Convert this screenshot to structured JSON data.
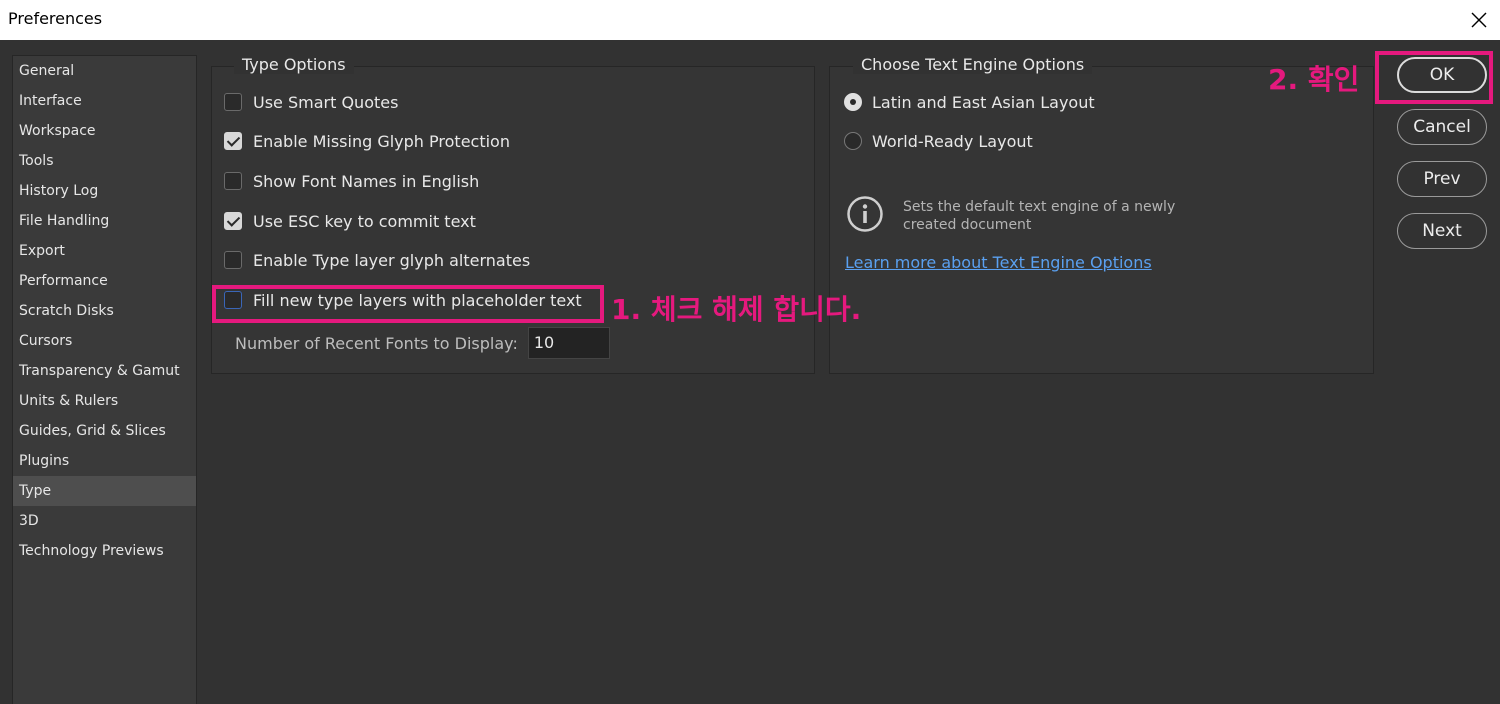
{
  "window": {
    "title": "Preferences",
    "close_icon": "close-icon"
  },
  "sidebar": {
    "items": [
      {
        "label": "General"
      },
      {
        "label": "Interface"
      },
      {
        "label": "Workspace"
      },
      {
        "label": "Tools"
      },
      {
        "label": "History Log"
      },
      {
        "label": "File Handling"
      },
      {
        "label": "Export"
      },
      {
        "label": "Performance"
      },
      {
        "label": "Scratch Disks"
      },
      {
        "label": "Cursors"
      },
      {
        "label": "Transparency & Gamut"
      },
      {
        "label": "Units & Rulers"
      },
      {
        "label": "Guides, Grid & Slices"
      },
      {
        "label": "Plugins"
      },
      {
        "label": "Type"
      },
      {
        "label": "3D"
      },
      {
        "label": "Technology Previews"
      }
    ],
    "active": "Type"
  },
  "type_options": {
    "legend": "Type Options",
    "checkboxes": [
      {
        "label": "Use Smart Quotes",
        "checked": false
      },
      {
        "label": "Enable Missing Glyph Protection",
        "checked": true
      },
      {
        "label": "Show Font Names in English",
        "checked": false
      },
      {
        "label": "Use ESC key to commit text",
        "checked": true
      },
      {
        "label": "Enable Type layer glyph alternates",
        "checked": false
      },
      {
        "label": "Fill new type layers with placeholder text",
        "checked": false
      }
    ],
    "recent_fonts_label": "Number of Recent Fonts to Display:",
    "recent_fonts_value": "10"
  },
  "engine_options": {
    "legend": "Choose Text Engine Options",
    "radios": [
      {
        "label": "Latin and East Asian Layout",
        "selected": true
      },
      {
        "label": "World-Ready Layout",
        "selected": false
      }
    ],
    "info_text": "Sets the default text engine of a newly created document",
    "learn_more_link": "Learn more about Text Engine Options"
  },
  "buttons": {
    "ok": "OK",
    "cancel": "Cancel",
    "prev": "Prev",
    "next": "Next"
  },
  "annotations": {
    "step1": "1. 체크 해제 합니다.",
    "step2": "2. 확인",
    "color": "#e5197e"
  }
}
